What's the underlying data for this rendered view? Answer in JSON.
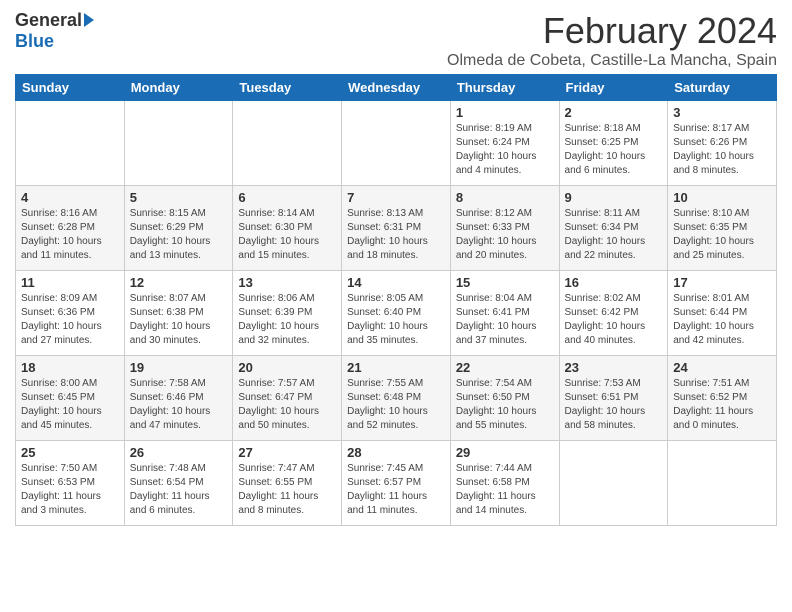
{
  "logo": {
    "general": "General",
    "blue": "Blue"
  },
  "title": "February 2024",
  "subtitle": "Olmeda de Cobeta, Castille-La Mancha, Spain",
  "headers": [
    "Sunday",
    "Monday",
    "Tuesday",
    "Wednesday",
    "Thursday",
    "Friday",
    "Saturday"
  ],
  "weeks": [
    [
      {
        "day": "",
        "info": ""
      },
      {
        "day": "",
        "info": ""
      },
      {
        "day": "",
        "info": ""
      },
      {
        "day": "",
        "info": ""
      },
      {
        "day": "1",
        "info": "Sunrise: 8:19 AM\nSunset: 6:24 PM\nDaylight: 10 hours and 4 minutes."
      },
      {
        "day": "2",
        "info": "Sunrise: 8:18 AM\nSunset: 6:25 PM\nDaylight: 10 hours and 6 minutes."
      },
      {
        "day": "3",
        "info": "Sunrise: 8:17 AM\nSunset: 6:26 PM\nDaylight: 10 hours and 8 minutes."
      }
    ],
    [
      {
        "day": "4",
        "info": "Sunrise: 8:16 AM\nSunset: 6:28 PM\nDaylight: 10 hours and 11 minutes."
      },
      {
        "day": "5",
        "info": "Sunrise: 8:15 AM\nSunset: 6:29 PM\nDaylight: 10 hours and 13 minutes."
      },
      {
        "day": "6",
        "info": "Sunrise: 8:14 AM\nSunset: 6:30 PM\nDaylight: 10 hours and 15 minutes."
      },
      {
        "day": "7",
        "info": "Sunrise: 8:13 AM\nSunset: 6:31 PM\nDaylight: 10 hours and 18 minutes."
      },
      {
        "day": "8",
        "info": "Sunrise: 8:12 AM\nSunset: 6:33 PM\nDaylight: 10 hours and 20 minutes."
      },
      {
        "day": "9",
        "info": "Sunrise: 8:11 AM\nSunset: 6:34 PM\nDaylight: 10 hours and 22 minutes."
      },
      {
        "day": "10",
        "info": "Sunrise: 8:10 AM\nSunset: 6:35 PM\nDaylight: 10 hours and 25 minutes."
      }
    ],
    [
      {
        "day": "11",
        "info": "Sunrise: 8:09 AM\nSunset: 6:36 PM\nDaylight: 10 hours and 27 minutes."
      },
      {
        "day": "12",
        "info": "Sunrise: 8:07 AM\nSunset: 6:38 PM\nDaylight: 10 hours and 30 minutes."
      },
      {
        "day": "13",
        "info": "Sunrise: 8:06 AM\nSunset: 6:39 PM\nDaylight: 10 hours and 32 minutes."
      },
      {
        "day": "14",
        "info": "Sunrise: 8:05 AM\nSunset: 6:40 PM\nDaylight: 10 hours and 35 minutes."
      },
      {
        "day": "15",
        "info": "Sunrise: 8:04 AM\nSunset: 6:41 PM\nDaylight: 10 hours and 37 minutes."
      },
      {
        "day": "16",
        "info": "Sunrise: 8:02 AM\nSunset: 6:42 PM\nDaylight: 10 hours and 40 minutes."
      },
      {
        "day": "17",
        "info": "Sunrise: 8:01 AM\nSunset: 6:44 PM\nDaylight: 10 hours and 42 minutes."
      }
    ],
    [
      {
        "day": "18",
        "info": "Sunrise: 8:00 AM\nSunset: 6:45 PM\nDaylight: 10 hours and 45 minutes."
      },
      {
        "day": "19",
        "info": "Sunrise: 7:58 AM\nSunset: 6:46 PM\nDaylight: 10 hours and 47 minutes."
      },
      {
        "day": "20",
        "info": "Sunrise: 7:57 AM\nSunset: 6:47 PM\nDaylight: 10 hours and 50 minutes."
      },
      {
        "day": "21",
        "info": "Sunrise: 7:55 AM\nSunset: 6:48 PM\nDaylight: 10 hours and 52 minutes."
      },
      {
        "day": "22",
        "info": "Sunrise: 7:54 AM\nSunset: 6:50 PM\nDaylight: 10 hours and 55 minutes."
      },
      {
        "day": "23",
        "info": "Sunrise: 7:53 AM\nSunset: 6:51 PM\nDaylight: 10 hours and 58 minutes."
      },
      {
        "day": "24",
        "info": "Sunrise: 7:51 AM\nSunset: 6:52 PM\nDaylight: 11 hours and 0 minutes."
      }
    ],
    [
      {
        "day": "25",
        "info": "Sunrise: 7:50 AM\nSunset: 6:53 PM\nDaylight: 11 hours and 3 minutes."
      },
      {
        "day": "26",
        "info": "Sunrise: 7:48 AM\nSunset: 6:54 PM\nDaylight: 11 hours and 6 minutes."
      },
      {
        "day": "27",
        "info": "Sunrise: 7:47 AM\nSunset: 6:55 PM\nDaylight: 11 hours and 8 minutes."
      },
      {
        "day": "28",
        "info": "Sunrise: 7:45 AM\nSunset: 6:57 PM\nDaylight: 11 hours and 11 minutes."
      },
      {
        "day": "29",
        "info": "Sunrise: 7:44 AM\nSunset: 6:58 PM\nDaylight: 11 hours and 14 minutes."
      },
      {
        "day": "",
        "info": ""
      },
      {
        "day": "",
        "info": ""
      }
    ]
  ]
}
